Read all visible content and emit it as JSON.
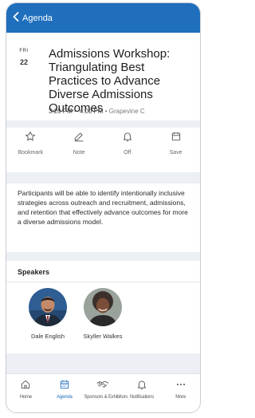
{
  "nav": {
    "back_label": "Agenda"
  },
  "session": {
    "day_of_week": "FRI",
    "day_number": "22",
    "title": "Admissions Workshop: Triangulating Best Practices to Advance Diverse Admissions Outcomes",
    "time_range": "3:20 PM – 4:00 PM",
    "separator": " • ",
    "location": "Grapevine C"
  },
  "actions": [
    {
      "label": "Bookmark",
      "icon": "star-icon"
    },
    {
      "label": "Note",
      "icon": "pencil-icon"
    },
    {
      "label": "Off",
      "icon": "bell-icon"
    },
    {
      "label": "Save",
      "icon": "calendar-icon"
    }
  ],
  "description": "Participants will be able to identify intentionally inclusive strategies across outreach and recruitment, admissions, and retention that effectively advance outcomes for more a diverse admissions model.",
  "speakers": {
    "heading": "Speakers",
    "items": [
      {
        "name": "Dale English"
      },
      {
        "name": "Skyller Walkes"
      }
    ]
  },
  "tabbar": {
    "active": "Agenda",
    "accent": "#1f6fbd",
    "tabs": [
      {
        "label": "Home",
        "icon": "home-icon"
      },
      {
        "label": "Agenda",
        "icon": "calendar-icon"
      },
      {
        "label": "Sponsors & Exhibitors",
        "icon": "handshake-icon"
      },
      {
        "label": "Notifications",
        "icon": "bell-icon"
      },
      {
        "label": "More",
        "icon": "ellipsis-icon"
      }
    ]
  }
}
